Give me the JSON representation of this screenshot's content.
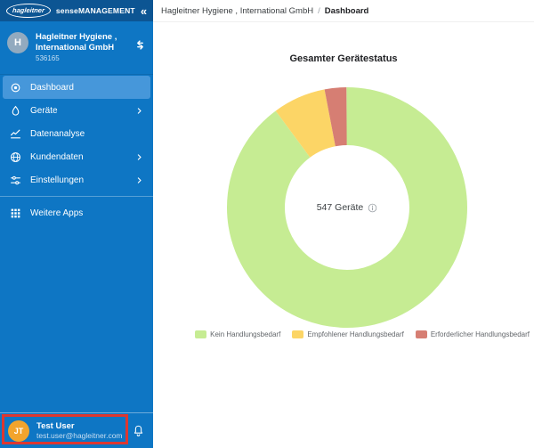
{
  "app": {
    "logo_text": "hagleitner",
    "brand": "senseMANAGEMENT",
    "collapse_glyph": "«"
  },
  "account": {
    "initial": "H",
    "name": "Hagleitner Hygiene , International GmbH",
    "id": "536165"
  },
  "sidebar": {
    "items": [
      {
        "label": "Dashboard",
        "icon": "target-icon",
        "active": true,
        "has_submenu": false
      },
      {
        "label": "Geräte",
        "icon": "droplet-icon",
        "active": false,
        "has_submenu": true
      },
      {
        "label": "Datenanalyse",
        "icon": "chart-icon",
        "active": false,
        "has_submenu": false
      },
      {
        "label": "Kundendaten",
        "icon": "globe-icon",
        "active": false,
        "has_submenu": true
      },
      {
        "label": "Einstellungen",
        "icon": "sliders-icon",
        "active": false,
        "has_submenu": true
      },
      {
        "label": "Weitere Apps",
        "icon": "grid-icon",
        "active": false,
        "has_submenu": false
      }
    ]
  },
  "user": {
    "initials": "JT",
    "name": "Test User",
    "email": "test.user@hagleitner.com",
    "avatar_color": "#F2A42D"
  },
  "annotation": {
    "color": "#DD3730"
  },
  "breadcrumb": {
    "parent": "Hagleitner Hygiene , International GmbH",
    "separator": "/",
    "current": "Dashboard"
  },
  "chart_data": {
    "type": "pie",
    "donut": true,
    "inner_radius_ratio": 0.52,
    "title": "Gesamter Gerätestatus",
    "center_label": "547 Geräte",
    "total": 547,
    "legend_position": "bottom",
    "series": [
      {
        "name": "Kein Handlungsbedarf",
        "value": 492,
        "percent": 90.0,
        "color": "#C6EC93"
      },
      {
        "name": "Empfohlener Handlungsbedarf",
        "value": 39,
        "percent": 7.1,
        "color": "#FCD566"
      },
      {
        "name": "Erforderlicher Handlungsbedarf",
        "value": 16,
        "percent": 2.9,
        "color": "#D67E73"
      }
    ]
  }
}
